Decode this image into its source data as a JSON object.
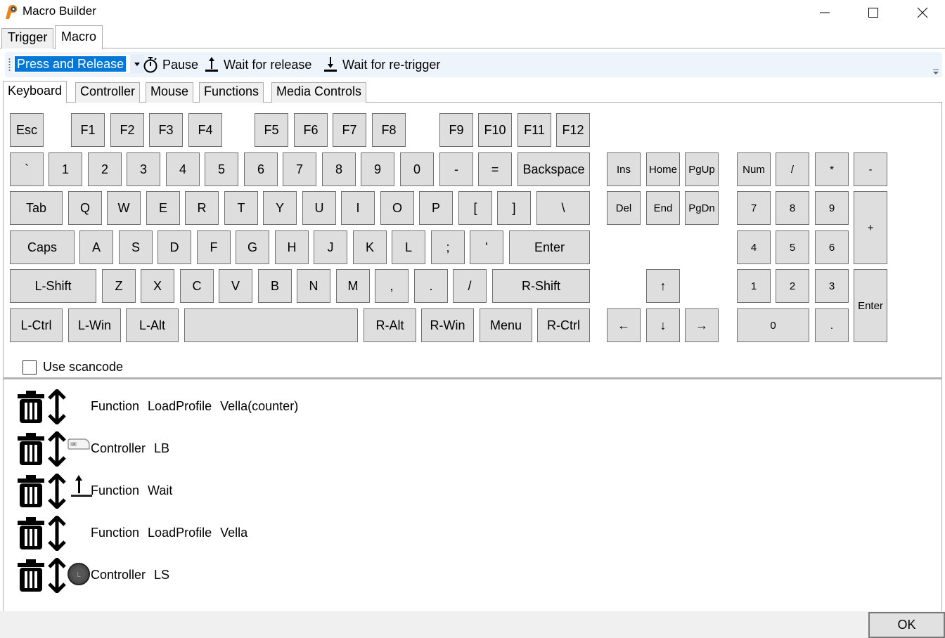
{
  "window": {
    "title": "Macro Builder",
    "controls": [
      "minimize",
      "maximize",
      "close"
    ]
  },
  "top_tabs": [
    {
      "label": "Trigger",
      "active": false
    },
    {
      "label": "Macro",
      "active": true
    }
  ],
  "toolbar": {
    "mode_select": {
      "value": "Press and Release"
    },
    "pause_label": "Pause",
    "wait_release_label": "Wait for release",
    "wait_retrigger_label": "Wait for re-trigger"
  },
  "sub_tabs": [
    {
      "label": "Keyboard",
      "active": true
    },
    {
      "label": "Controller",
      "active": false
    },
    {
      "label": "Mouse",
      "active": false
    },
    {
      "label": "Functions",
      "active": false
    },
    {
      "label": "Media Controls",
      "active": false
    }
  ],
  "keyboard": {
    "rows": {
      "function": [
        "Esc",
        "F1",
        "F2",
        "F3",
        "F4",
        "F5",
        "F6",
        "F7",
        "F8",
        "F9",
        "F10",
        "F11",
        "F12"
      ],
      "number": [
        "`",
        "1",
        "2",
        "3",
        "4",
        "5",
        "6",
        "7",
        "8",
        "9",
        "0",
        "-",
        "=",
        "Backspace"
      ],
      "top": [
        "Tab",
        "Q",
        "W",
        "E",
        "R",
        "T",
        "Y",
        "U",
        "I",
        "O",
        "P",
        "[",
        "]",
        "\\"
      ],
      "home": [
        "Caps",
        "A",
        "S",
        "D",
        "F",
        "G",
        "H",
        "J",
        "K",
        "L",
        ";",
        "'",
        "Enter"
      ],
      "bottom": [
        "L-Shift",
        "Z",
        "X",
        "C",
        "V",
        "B",
        "N",
        "M",
        ",",
        ".",
        "/",
        "R-Shift"
      ],
      "space": [
        "L-Ctrl",
        "L-Win",
        "L-Alt",
        "",
        "R-Alt",
        "R-Win",
        "Menu",
        "R-Ctrl"
      ]
    },
    "nav": [
      "Ins",
      "Home",
      "PgUp",
      "Del",
      "End",
      "PgDn"
    ],
    "arrows": [
      "↑",
      "←",
      "↓",
      "→"
    ],
    "numpad": [
      "Num",
      "/",
      "*",
      "-",
      "7",
      "8",
      "9",
      "+",
      "4",
      "5",
      "6",
      "1",
      "2",
      "3",
      "Enter",
      "0",
      "."
    ],
    "use_scancode_label": "Use scancode",
    "use_scancode_checked": false
  },
  "macro_list": [
    {
      "icon": "none",
      "parts": [
        "Function",
        "LoadProfile",
        "Vella(counter)"
      ]
    },
    {
      "icon": "controller-lb-icon",
      "parts": [
        "Controller",
        "LB"
      ]
    },
    {
      "icon": "wait-release-icon",
      "parts": [
        "Function",
        "Wait"
      ]
    },
    {
      "icon": "none",
      "parts": [
        "Function",
        "LoadProfile",
        "Vella"
      ]
    },
    {
      "icon": "controller-ls-icon",
      "parts": [
        "Controller",
        "LS"
      ]
    }
  ],
  "footer": {
    "ok_label": "OK"
  }
}
